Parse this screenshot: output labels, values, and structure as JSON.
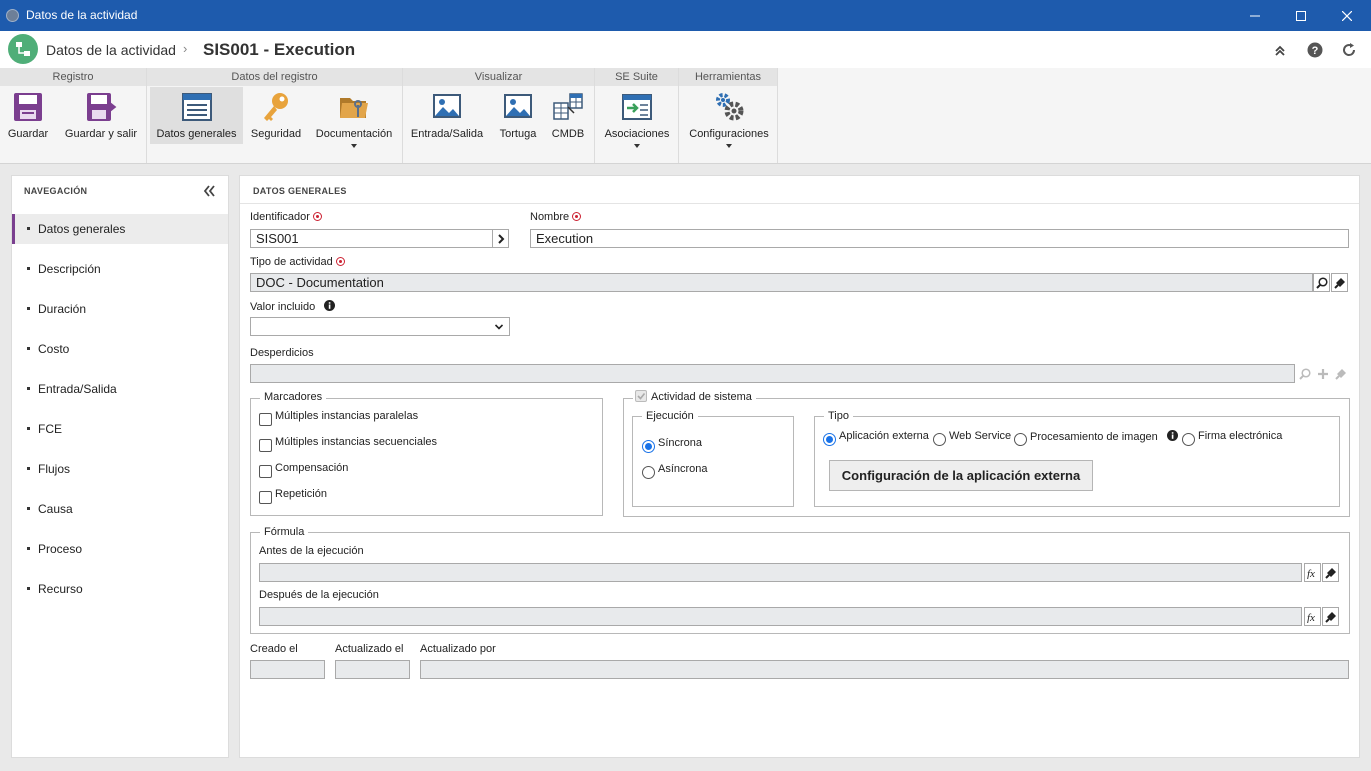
{
  "window": {
    "title": "Datos de la actividad"
  },
  "header": {
    "breadcrumb": "Datos de la actividad",
    "title": "SIS001 - Execution"
  },
  "ribbon": {
    "groups": [
      "Registro",
      "Datos del registro",
      "Visualizar",
      "SE Suite",
      "Herramientas"
    ],
    "buttons": {
      "save": "Guardar",
      "save_exit": "Guardar y salir",
      "general": "Datos generales",
      "security": "Seguridad",
      "documentation": "Documentación",
      "io": "Entrada/Salida",
      "turtle": "Tortuga",
      "cmdb": "CMDB",
      "associations": "Asociaciones",
      "settings": "Configuraciones"
    }
  },
  "nav": {
    "title": "NAVEGACIÓN",
    "items": [
      "Datos generales",
      "Descripción",
      "Duración",
      "Costo",
      "Entrada/Salida",
      "FCE",
      "Flujos",
      "Causa",
      "Proceso",
      "Recurso"
    ]
  },
  "main": {
    "section": "DATOS GENERALES",
    "id_label": "Identificador",
    "id_value": "SIS001",
    "name_label": "Nombre",
    "name_value": "Execution",
    "type_label": "Tipo de actividad",
    "type_value": "DOC - Documentation",
    "value_label": "Valor incluido",
    "value_selected": "",
    "waste_label": "Desperdicios",
    "markers": {
      "legend": "Marcadores",
      "items": [
        "Múltiples instancias paralelas",
        "Múltiples instancias secuenciales",
        "Compensación",
        "Repetición"
      ]
    },
    "system": {
      "legend": "Actividad de sistema",
      "execution_legend": "Ejecución",
      "sync": "Síncrona",
      "async": "Asíncrona",
      "type_legend": "Tipo",
      "types": [
        "Aplicación externa",
        "Web Service",
        "Procesamiento de imagen",
        "Firma electrónica"
      ],
      "config_button": "Configuración de la aplicación externa"
    },
    "formula": {
      "legend": "Fórmula",
      "before": "Antes de la ejecución",
      "after": "Después de la ejecución"
    },
    "created_label": "Creado el",
    "updated_label": "Actualizado el",
    "updated_by_label": "Actualizado por"
  }
}
